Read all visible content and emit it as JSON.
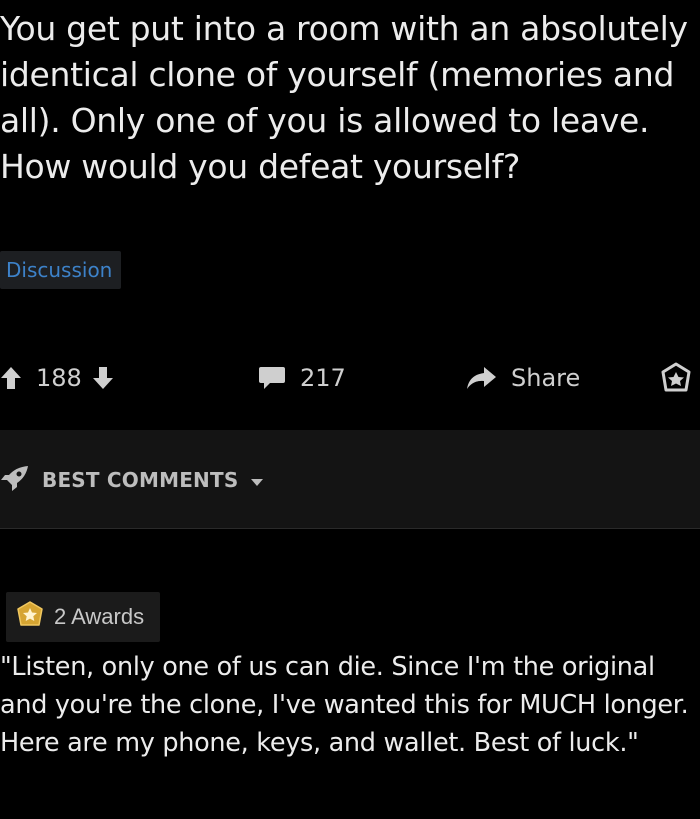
{
  "post": {
    "title": "You get put into a room with an absolutely identical clone of yourself (memories and all). Only one of you is allowed to leave. How would you defeat yourself?",
    "flair": "Discussion"
  },
  "actions": {
    "upvotes": "188",
    "comments": "217",
    "share_label": "Share"
  },
  "sort": {
    "label": "BEST COMMENTS"
  },
  "comment": {
    "awards_label": "2 Awards",
    "body": "\"Listen, only one of us can die. Since I'm the original and you're the clone, I've wanted this for MUCH longer. Here are my phone, keys, and wallet. Best of luck.\""
  },
  "icons": {
    "upvote": "arrow-up-icon",
    "downvote": "arrow-down-icon",
    "comments": "speech-bubble-icon",
    "share": "share-arrow-icon",
    "award": "award-icon",
    "sort": "rocket-icon",
    "sort_caret": "caret-down-icon"
  },
  "colors": {
    "background": "#000000",
    "text": "#ececec",
    "flair_text": "#3d82c9",
    "flair_bg": "#1d1f22",
    "award_gold": "#d6a532"
  }
}
